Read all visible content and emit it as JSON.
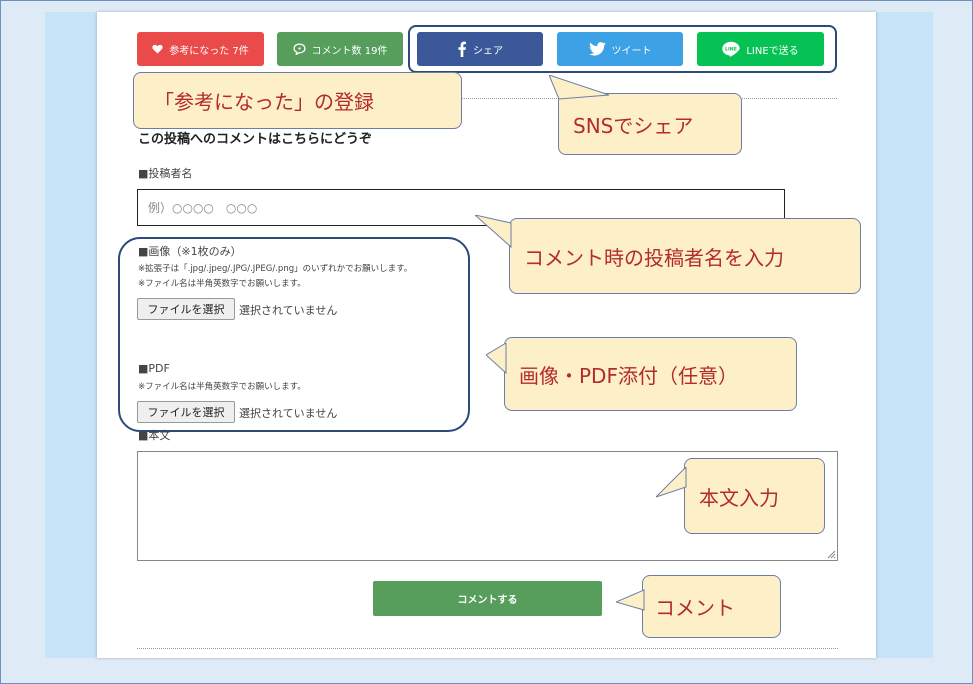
{
  "reaction_bar": {
    "helpful_button": {
      "label": "参考になった 7件",
      "color": "#ea4a4a"
    },
    "comments_button": {
      "label": "コメント数 19件",
      "color": "#579e5d"
    },
    "share_facebook": {
      "label": "シェア",
      "color": "#3b5998"
    },
    "share_twitter": {
      "label": "ツイート",
      "color": "#3ca2e5"
    },
    "share_line": {
      "label": "LINEで送る",
      "color": "#06c255"
    }
  },
  "form": {
    "heading": "この投稿へのコメントはこちらにどうぞ",
    "poster_name_label": "■投稿者名",
    "poster_name_placeholder": "例）○○○○　○○○",
    "image_label": "■画像（※1枚のみ）",
    "image_note_1": "※拡張子は「.jpg/.jpeg/.JPG/.JPEG/.png」のいずれかでお願いします。",
    "image_note_2": "※ファイル名は半角英数字でお願いします。",
    "image_file_button": "ファイルを選択",
    "image_file_status": "選択されていません",
    "pdf_label": "■PDF",
    "pdf_note": "※ファイル名は半角英数字でお願いします。",
    "pdf_file_button": "ファイルを選択",
    "pdf_file_status": "選択されていません",
    "body_label": "■本文",
    "submit_label": "コメントする"
  },
  "callouts": {
    "helpful": "「参考になった」の登録",
    "sns": "SNSでシェア",
    "poster_name": "コメント時の投稿者名を入力",
    "attachments": "画像・PDF添付（任意）",
    "body": "本文入力",
    "comment": "コメント"
  }
}
